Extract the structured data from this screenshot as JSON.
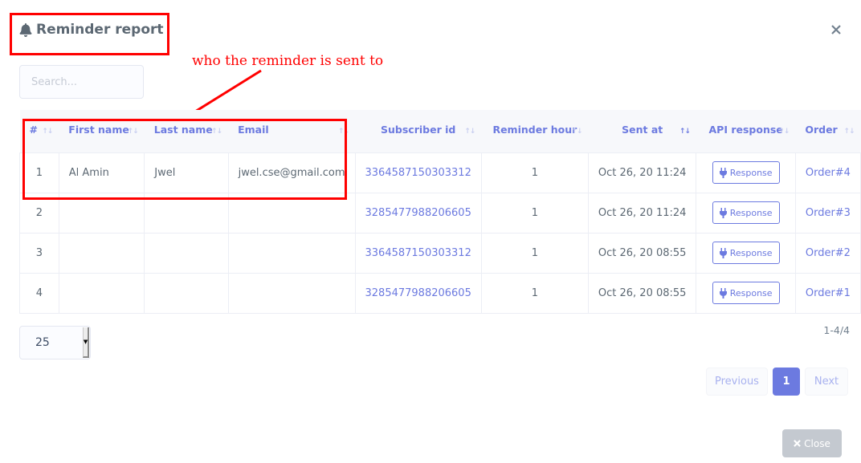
{
  "modal": {
    "title": "Reminder report",
    "title_icon": "bell-icon",
    "close_icon": "close-icon"
  },
  "annotation": {
    "text": "who the reminder is sent to"
  },
  "search": {
    "placeholder": "Search...",
    "value": ""
  },
  "table": {
    "columns": [
      {
        "label": "#",
        "sort": "none"
      },
      {
        "label": "First name",
        "sort": "none"
      },
      {
        "label": "Last name",
        "sort": "none"
      },
      {
        "label": "Email",
        "sort": "none"
      },
      {
        "label": "Subscriber id",
        "sort": "none"
      },
      {
        "label": "Reminder hour",
        "sort": "none"
      },
      {
        "label": "Sent at",
        "sort": "desc"
      },
      {
        "label": "API response",
        "sort": "none"
      },
      {
        "label": "Order",
        "sort": "none"
      }
    ],
    "sort_icon": "↑↓",
    "rows": [
      {
        "num": "1",
        "first_name": "Al Amin",
        "last_name": "Jwel",
        "email": "jwel.cse@gmail.com",
        "subscriber_id": "3364587150303312",
        "reminder_hour": "1",
        "sent_at": "Oct 26, 20 11:24",
        "api_response": "Response",
        "order": "Order#4"
      },
      {
        "num": "2",
        "first_name": "",
        "last_name": "",
        "email": "",
        "subscriber_id": "3285477988206605",
        "reminder_hour": "1",
        "sent_at": "Oct 26, 20 11:24",
        "api_response": "Response",
        "order": "Order#3"
      },
      {
        "num": "3",
        "first_name": "",
        "last_name": "",
        "email": "",
        "subscriber_id": "3364587150303312",
        "reminder_hour": "1",
        "sent_at": "Oct 26, 20 08:55",
        "api_response": "Response",
        "order": "Order#2"
      },
      {
        "num": "4",
        "first_name": "",
        "last_name": "",
        "email": "",
        "subscriber_id": "3285477988206605",
        "reminder_hour": "1",
        "sent_at": "Oct 26, 20 08:55",
        "api_response": "Response",
        "order": "Order#1"
      }
    ]
  },
  "footer": {
    "per_page": "25",
    "range": "1-4/4",
    "pagination": {
      "previous": "Previous",
      "current": "1",
      "next": "Next"
    },
    "close_label": "Close"
  },
  "colors": {
    "accent": "#6c7ae0",
    "annotation": "#ff0000",
    "close_button": "#c4c9d0"
  }
}
